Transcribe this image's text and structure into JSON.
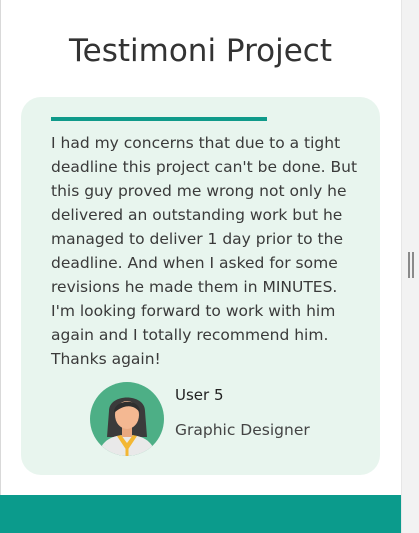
{
  "page": {
    "title": "Testimoni Project"
  },
  "testimonial": {
    "quote": "I had my concerns that due to a tight deadline this project can't be done. But this guy proved me wrong not only he delivered an outstanding work but he managed to deliver 1 day prior to the deadline. And when I asked for some revisions he made them in MINUTES. I'm looking forward to work with him again and I totally recommend him. Thanks again!",
    "user_name": "User 5",
    "user_role": "Graphic Designer",
    "avatar_icon": "user-avatar-icon"
  },
  "colors": {
    "accent": "#0f9a8a",
    "card_background": "#e8f5ee",
    "footer": "#0b9b8c"
  }
}
